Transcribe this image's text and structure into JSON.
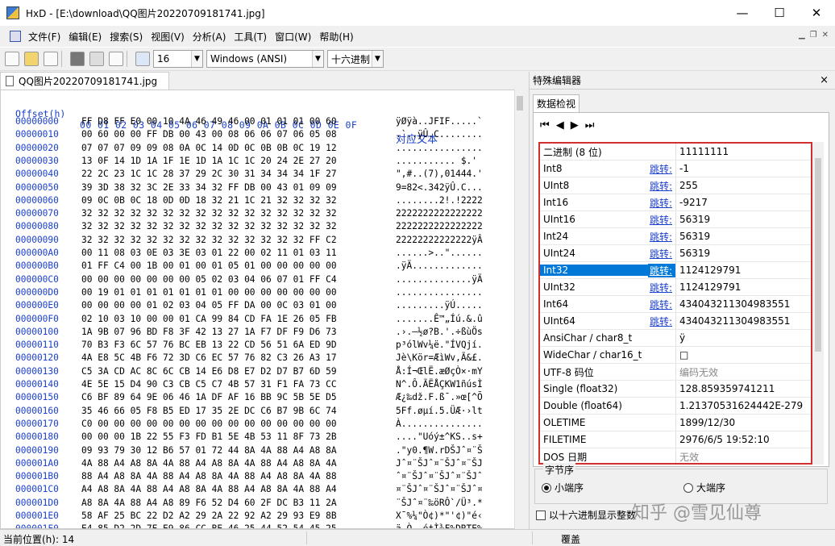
{
  "window": {
    "app": "HxD",
    "title": "HxD - [E:\\download\\QQ图片20220709181741.jpg]",
    "min": "—",
    "max": "☐",
    "close": "✕"
  },
  "menu": [
    "文件(F)",
    "编辑(E)",
    "搜索(S)",
    "视图(V)",
    "分析(A)",
    "工具(T)",
    "窗口(W)",
    "帮助(H)"
  ],
  "toolbar": {
    "bytes_per_row": "16",
    "charset": "Windows (ANSI)",
    "offset_base": "十六进制"
  },
  "doc_tab": "QQ图片20220709181741.jpg",
  "hex": {
    "header_offset": "Offset(h)",
    "header_cols": "00 01 02 03 04 05 06 07 08 09 0A 0B 0C 0D 0E 0F",
    "header_text": "对应文本",
    "rows": [
      {
        "off": "00000000",
        "bytes": "FF D8 FF E0 00 10 4A 46 49 46 00 01 01 01 00 60",
        "text": "ÿØÿà..JFIF.....`"
      },
      {
        "off": "00000010",
        "bytes": "00 60 00 00 FF DB 00 43 00 08 06 06 07 06 05 08",
        "text": ".`..ÿÛ.C........"
      },
      {
        "off": "00000020",
        "bytes": "07 07 07 09 09 08 0A 0C 14 0D 0C 0B 0B 0C 19 12",
        "text": "................"
      },
      {
        "off": "00000030",
        "bytes": "13 0F 14 1D 1A 1F 1E 1D 1A 1C 1C 20 24 2E 27 20",
        "text": "........... $.' "
      },
      {
        "off": "00000040",
        "bytes": "22 2C 23 1C 1C 28 37 29 2C 30 31 34 34 34 1F 27",
        "text": "\",#..(7),01444.'"
      },
      {
        "off": "00000050",
        "bytes": "39 3D 38 32 3C 2E 33 34 32 FF DB 00 43 01 09 09",
        "text": "9=82<.342ÿÛ.C..."
      },
      {
        "off": "00000060",
        "bytes": "09 0C 0B 0C 18 0D 0D 18 32 21 1C 21 32 32 32 32",
        "text": "........2!.!2222"
      },
      {
        "off": "00000070",
        "bytes": "32 32 32 32 32 32 32 32 32 32 32 32 32 32 32 32",
        "text": "2222222222222222"
      },
      {
        "off": "00000080",
        "bytes": "32 32 32 32 32 32 32 32 32 32 32 32 32 32 32 32",
        "text": "2222222222222222"
      },
      {
        "off": "00000090",
        "bytes": "32 32 32 32 32 32 32 32 32 32 32 32 32 32 FF C2",
        "text": "22222222222222ÿÂ"
      },
      {
        "off": "000000A0",
        "bytes": "00 11 08 03 0E 03 3E 03 01 22 00 02 11 01 03 11",
        "text": "......>..\"......"
      },
      {
        "off": "000000B0",
        "bytes": "01 FF C4 00 1B 00 01 00 01 05 01 00 00 00 00 00",
        "text": ".ÿÄ............."
      },
      {
        "off": "000000C0",
        "bytes": "00 00 00 00 00 00 00 05 02 03 04 06 07 01 FF C4",
        "text": "..............ÿÄ"
      },
      {
        "off": "000000D0",
        "bytes": "00 19 01 01 01 01 01 01 01 00 00 00 00 00 00 00",
        "text": "................"
      },
      {
        "off": "000000E0",
        "bytes": "00 00 00 00 01 02 03 04 05 FF DA 00 0C 03 01 00",
        "text": ".........ÿÚ....."
      },
      {
        "off": "000000F0",
        "bytes": "02 10 03 10 00 00 01 CA 99 84 CD FA 1E 26 05 FB",
        "text": ".......Ê™„Íú.&.û"
      },
      {
        "off": "00000100",
        "bytes": "1A 9B 07 96 BD F8 3F 42 13 27 1A F7 DF F9 D6 73",
        "text": ".›.–½ø?B.'.÷ßùÖs"
      },
      {
        "off": "00000110",
        "bytes": "70 B3 F3 6C 57 76 BC EB 13 22 CD 56 51 6A ED 9D",
        "text": "p³ólWv¼ë.\"ÍVQjí."
      },
      {
        "off": "00000120",
        "bytes": "4A E8 5C 4B F6 72 3D C6 EC 57 76 82 C3 26 A3 17",
        "text": "Jè\\Kör=ÆìWv‚Ã&£."
      },
      {
        "off": "00000130",
        "bytes": "C5 3A CD AC 8C 6C CB 14 E6 D8 E7 D2 D7 B7 6D 59",
        "text": "Å:Í¬ŒlË.æØçÒ×·mY"
      },
      {
        "off": "00000140",
        "bytes": "4E 5E 15 D4 90 C3 CB C5 C7 4B 57 31 F1 FA 73 CC",
        "text": "N^.Ô.ÃËÅÇKW1ñúsÌ"
      },
      {
        "off": "00000150",
        "bytes": "C6 BF 89 64 9E 06 46 1A DF AF 16 BB 9C 5B 5E D5",
        "text": "Æ¿‰dž.F.ß¯.»œ[^Õ"
      },
      {
        "off": "00000160",
        "bytes": "35 46 66 05 F8 B5 ED 17 35 2E DC C6 B7 9B 6C 74",
        "text": "5Ff.øµí.5.ÜÆ·›lt"
      },
      {
        "off": "00000170",
        "bytes": "C0 00 00 00 00 00 00 00 00 00 00 00 00 00 00 00",
        "text": "À..............."
      },
      {
        "off": "00000180",
        "bytes": "00 00 00 1B 22 55 F3 FD B1 5E 4B 53 11 8F 73 2B",
        "text": "....\"Uóý±^KS..s+"
      },
      {
        "off": "00000190",
        "bytes": "09 93 79 30 12 B6 57 01 72 44 8A 4A 88 A4 A8 8A",
        "text": ".\"y0.¶W.rDŠJˆ¤¨Š"
      },
      {
        "off": "000001A0",
        "bytes": "4A 88 A4 A8 8A 4A 88 A4 A8 8A 4A 88 A4 A8 8A 4A",
        "text": "Jˆ¤¨ŠJˆ¤¨ŠJˆ¤¨ŠJ"
      },
      {
        "off": "000001B0",
        "bytes": "88 A4 A8 8A 4A 88 A4 A8 8A 4A 88 A4 A8 8A 4A 88",
        "text": "ˆ¤¨ŠJˆ¤¨ŠJˆ¤¨ŠJˆ"
      },
      {
        "off": "000001C0",
        "bytes": "A4 A8 8A 4A 88 A4 A8 8A 4A 88 A4 A8 8A 4A 88 A4",
        "text": "¤¨ŠJˆ¤¨ŠJˆ¤¨ŠJˆ¤"
      },
      {
        "off": "000001D0",
        "bytes": "A8 8A 4A 88 A4 A8 89 F6 52 D4 60 2F DC B3 11 2A",
        "text": "¨ŠJˆ¤¨‰öRÔ`/Ü³.*"
      },
      {
        "off": "000001E0",
        "bytes": "58 AF 25 BC 22 D2 A2 29 2A 22 92 A2 29 93 E9 8B",
        "text": "X¯%¼\"Ò¢)*\"'¢)\"é‹"
      },
      {
        "off": "000001F0",
        "bytes": "E4 85 D2 2D 7F E9 86 CC BE 46 25 44 52 54 45 25",
        "text": "ä…Ò-.é†Ì¾F%DRTE%"
      }
    ]
  },
  "side": {
    "title": "特殊编辑器",
    "close": "×",
    "tab": "数据检视",
    "nav": [
      "⏮",
      "◀",
      "▶",
      "⏭"
    ],
    "jump_label": "跳转:",
    "rows": [
      {
        "name": "二进制 (8 位)",
        "jump": false,
        "value": "11111111"
      },
      {
        "name": "Int8",
        "jump": true,
        "value": "-1"
      },
      {
        "name": "UInt8",
        "jump": true,
        "value": "255"
      },
      {
        "name": "Int16",
        "jump": true,
        "value": "-9217"
      },
      {
        "name": "UInt16",
        "jump": true,
        "value": "56319"
      },
      {
        "name": "Int24",
        "jump": true,
        "value": "56319"
      },
      {
        "name": "UInt24",
        "jump": true,
        "value": "56319"
      },
      {
        "name": "Int32",
        "jump": true,
        "value": "1124129791",
        "selected": true
      },
      {
        "name": "UInt32",
        "jump": true,
        "value": "1124129791"
      },
      {
        "name": "Int64",
        "jump": true,
        "value": "434043211304983551"
      },
      {
        "name": "UInt64",
        "jump": true,
        "value": "434043211304983551"
      },
      {
        "name": "AnsiChar / char8_t",
        "jump": false,
        "value": "ÿ"
      },
      {
        "name": "WideChar / char16_t",
        "jump": false,
        "value": "□"
      },
      {
        "name": "UTF-8 码位",
        "jump": false,
        "value": "编码无效",
        "disabled": true
      },
      {
        "name": "Single (float32)",
        "jump": false,
        "value": "128.859359741211"
      },
      {
        "name": "Double (float64)",
        "jump": false,
        "value": "1.21370531624442E-279"
      },
      {
        "name": "OLETIME",
        "jump": false,
        "value": "1899/12/30"
      },
      {
        "name": "FILETIME",
        "jump": false,
        "value": "2976/6/5 19:52:10"
      },
      {
        "name": "DOS 日期",
        "jump": false,
        "value": "无效",
        "disabled": true
      }
    ],
    "byte_order": "字节序",
    "little_endian": "小端序",
    "big_endian": "大端序",
    "hex_int": "以十六进制显示整数"
  },
  "watermark": "知乎 @雪见仙尊",
  "status": {
    "position": "当前位置(h): 14",
    "mode": "覆盖"
  }
}
